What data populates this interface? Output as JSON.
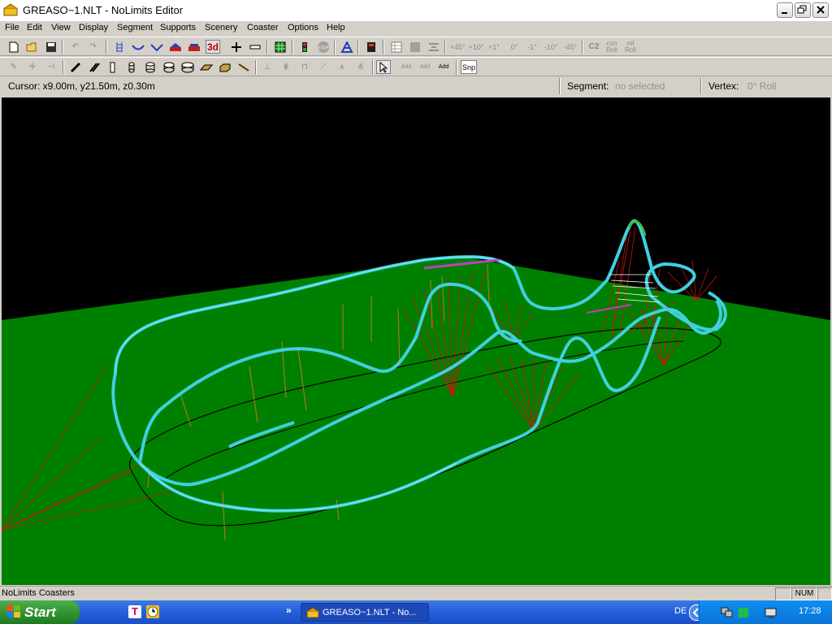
{
  "window": {
    "title": "GREASO~1.NLT - NoLimits Editor"
  },
  "menu": [
    "File",
    "Edit",
    "View",
    "Display",
    "Segment",
    "Supports",
    "Scenery",
    "Coaster",
    "Options",
    "Help"
  ],
  "toolbar1": {
    "three_d_label": "3d",
    "roll_buttons": [
      "+45°",
      "+10°",
      "+1°",
      "0°",
      "-1°",
      "-10°",
      "-45°"
    ],
    "c2_label": "C2",
    "con_roll_label": "con Roll",
    "rel_roll_label": "rel Roll"
  },
  "toolbar2": {
    "add_labels": [
      "Add",
      "Add",
      "Add"
    ],
    "snap_label": "Snp"
  },
  "status": {
    "cursor": "Cursor: x9.00m, y21.50m, z0.30m",
    "segment_label": "Segment:",
    "segment_value": "no selected",
    "vertex_label": "Vertex:",
    "vertex_value": "0° Roll"
  },
  "bottom_status": {
    "left": "NoLimits Coasters",
    "num": "NUM"
  },
  "taskbar": {
    "start": "Start",
    "task_item": "GREASO~1.NLT - No...",
    "language": "DE",
    "time": "17:28",
    "chevron": "»"
  },
  "colors": {
    "ground": "#008000",
    "sky": "#000000",
    "track": "#40d0e0",
    "supports_red": "#d01010",
    "supports_orange": "#c07820",
    "selected_segment": "#c040c0"
  }
}
